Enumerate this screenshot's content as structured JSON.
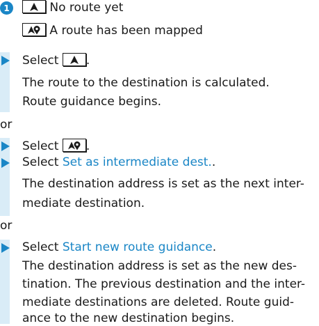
{
  "badge": "1",
  "legend": [
    {
      "icon": "no-route-icon",
      "text": "No route yet"
    },
    {
      "icon": "route-mapped-icon",
      "text": "A route has been mapped"
    }
  ],
  "step1": {
    "select_prefix": "Select",
    "select_suffix": ".",
    "result_lines": [
      "The route to the destination is calculated.",
      "Route guidance begins."
    ]
  },
  "or_label": "or",
  "step2": {
    "select_prefix": "Select",
    "select_suffix": ".",
    "option_prefix": "Select",
    "option_link": "Set as intermediate dest.",
    "option_suffix": ".",
    "result_lines": [
      "The destination address is set as the next inter-",
      "mediate destination."
    ]
  },
  "step3": {
    "option_prefix": "Select",
    "option_link": "Start new route guidance",
    "option_suffix": ".",
    "result_lines": [
      "The destination address is set as the new des-",
      "tination. The previous destination and the inter-",
      "mediate destinations are deleted. Route guid-",
      "ance to the new destination begins."
    ]
  },
  "colors": {
    "accent": "#1a86c6",
    "bar": "#d9ecf7",
    "text": "#1a1a1a"
  }
}
